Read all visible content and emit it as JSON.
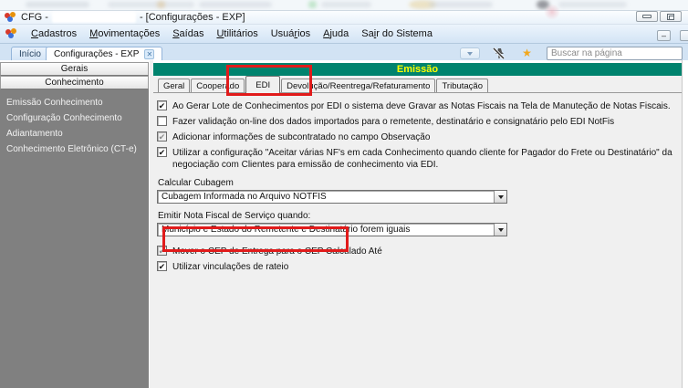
{
  "window": {
    "title_prefix": "CFG -",
    "title_suffix": "- [Configurações - EXP]"
  },
  "menu": {
    "items": [
      {
        "pre": "",
        "accel": "C",
        "post": "adastros"
      },
      {
        "pre": "",
        "accel": "M",
        "post": "ovimentações"
      },
      {
        "pre": "",
        "accel": "S",
        "post": "aídas"
      },
      {
        "pre": "",
        "accel": "U",
        "post": "tilitários"
      },
      {
        "pre": "Usuá",
        "accel": "r",
        "post": "ios"
      },
      {
        "pre": "",
        "accel": "A",
        "post": "juda"
      },
      {
        "pre": "Sa",
        "accel": "i",
        "post": "r do Sistema"
      }
    ]
  },
  "tabbar": {
    "tabs": [
      {
        "label": "Início"
      },
      {
        "label": "Configurações - EXP"
      }
    ],
    "close_glyph": "✕",
    "search_placeholder": "Buscar na página",
    "star_glyph": "★"
  },
  "sidebar": {
    "sections": [
      {
        "label": "Gerais"
      },
      {
        "label": "Conhecimento"
      }
    ],
    "items": [
      {
        "label": "Emissão Conhecimento"
      },
      {
        "label": "Configuração Conhecimento"
      },
      {
        "label": "Adiantamento"
      },
      {
        "label": "Conhecimento Eletrônico (CT-e)"
      }
    ]
  },
  "panel": {
    "header": "Emissão",
    "active_tab": "EDI",
    "tabs": [
      {
        "label": "Geral"
      },
      {
        "label": "Cooperado"
      },
      {
        "label": "EDI"
      },
      {
        "label": "Devolução/Reentrega/Refaturamento"
      },
      {
        "label": "Tributação"
      }
    ],
    "checkboxes": [
      {
        "label": "Ao Gerar Lote de Conhecimentos por EDI o sistema deve Gravar as Notas Fiscais na Tela de Manuteção de Notas Fiscais.",
        "state": "checked"
      },
      {
        "label": "Fazer validação on-line dos dados importados para o remetente, destinatário e consignatário pelo EDI NotFis",
        "state": "unchecked"
      },
      {
        "label": "Adicionar informações de subcontratado no campo Observação",
        "state": "checked-disabled"
      },
      {
        "label": "Utilizar a configuração \"Aceitar várias NF's em cada Conhecimento quando cliente for Pagador do Frete ou Destinatário\" da negociação com Clientes para emissão de conhecimento via EDI.",
        "state": "checked"
      }
    ],
    "fields": [
      {
        "label": "Calcular Cubagem",
        "value": "Cubagem Informada no Arquivo NOTFIS"
      },
      {
        "label": "Emitir Nota Fiscal de Serviço quando:",
        "value": "Município e Estado do Remetente e Destinatário forem iguais"
      }
    ],
    "checkboxes2": [
      {
        "label": "Mover o CEP de Entrega para o CEP Calculado Até",
        "state": "checked-disabled"
      },
      {
        "label": "Utilizar vinculações de rateio",
        "state": "checked"
      }
    ]
  },
  "colors": {
    "header_teal": "#00836E",
    "header_text": "#FFFF00",
    "annotation": "#E11B1B",
    "sidebar_gray": "#808080",
    "star": "#F2A71B"
  }
}
